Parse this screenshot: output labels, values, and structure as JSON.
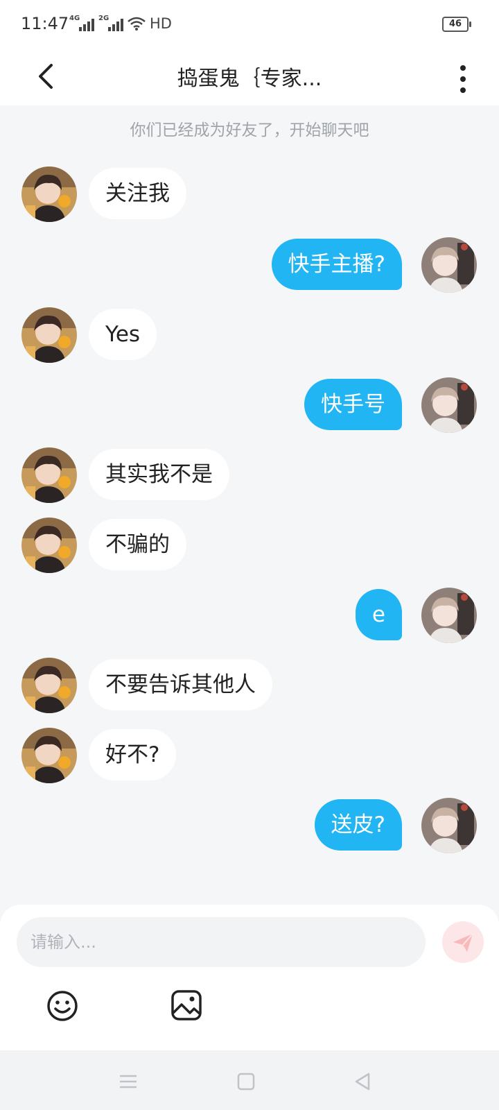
{
  "status": {
    "time": "11:47",
    "net1": "4G",
    "net2": "2G",
    "hd": "HD",
    "battery": "46"
  },
  "header": {
    "title": "捣蛋鬼｛专家..."
  },
  "system_message": "你们已经成为好友了，开始聊天吧",
  "messages": [
    {
      "side": "left",
      "text": "关注我"
    },
    {
      "side": "right",
      "text": "快手主播?"
    },
    {
      "side": "left",
      "text": "Yes"
    },
    {
      "side": "right",
      "text": "快手号"
    },
    {
      "side": "left",
      "text": "其实我不是"
    },
    {
      "side": "left",
      "text": "不骗的"
    },
    {
      "side": "right",
      "text": "e"
    },
    {
      "side": "left",
      "text": "不要告诉其他人"
    },
    {
      "side": "left",
      "text": "好不?"
    },
    {
      "side": "right",
      "text": "送皮?"
    }
  ],
  "input": {
    "placeholder": "请输入..."
  },
  "colors": {
    "accent": "#21b5f4",
    "send_disabled": "#fde6e7",
    "background": "#f4f6f8"
  },
  "icons": [
    "back-arrow-icon",
    "more-vertical-icon",
    "send-icon",
    "emoji-icon",
    "image-icon",
    "menu-icon",
    "home-icon",
    "back-nav-icon"
  ]
}
